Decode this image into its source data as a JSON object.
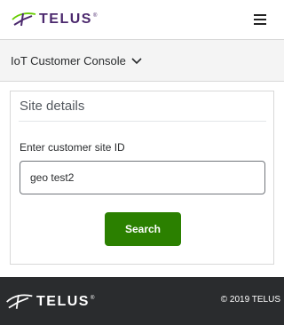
{
  "header": {
    "brand": "TELUS",
    "brand_reg": "®",
    "menu_icon": "hamburger-menu-icon"
  },
  "console": {
    "title": "IoT Customer Console",
    "dropdown_icon": "chevron-down-icon"
  },
  "site_details": {
    "title": "Site details",
    "field_label": "Enter customer site ID",
    "input_value": "geo test2",
    "search_label": "Search"
  },
  "footer": {
    "brand": "TELUS",
    "brand_reg": "®",
    "copyright": "© 2019 TELUS"
  },
  "colors": {
    "brand_purple": "#4b286d",
    "brand_green": "#66cc00",
    "button_green": "#2b8000",
    "footer_bg": "#2a2c2e"
  }
}
